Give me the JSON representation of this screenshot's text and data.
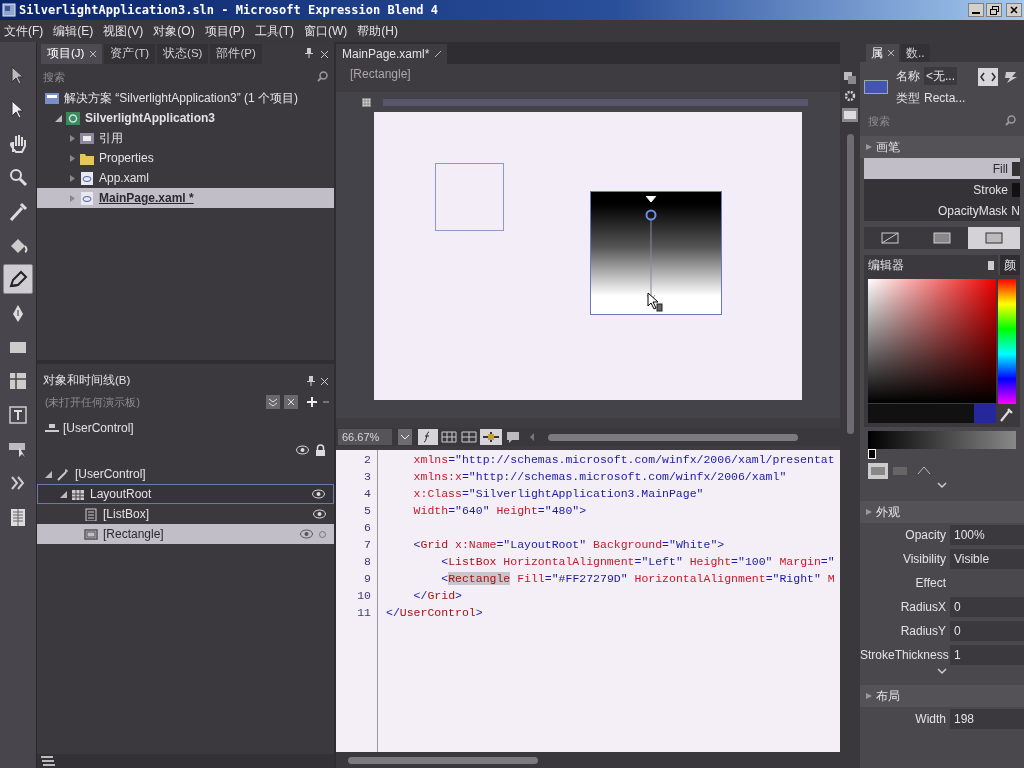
{
  "window": {
    "title": "SilverlightApplication3.sln - Microsoft Expression Blend 4"
  },
  "menu": [
    "文件(F)",
    "编辑(E)",
    "视图(V)",
    "对象(O)",
    "项目(P)",
    "工具(T)",
    "窗口(W)",
    "帮助(H)"
  ],
  "tools": [
    {
      "selected": false
    },
    {
      "selected": false
    },
    {
      "selected": false
    },
    {
      "selected": false
    },
    {
      "selected": false
    },
    {
      "selected": false
    },
    {
      "selected": true
    },
    {
      "selected": false
    },
    {
      "selected": false
    },
    {
      "selected": false
    },
    {
      "selected": false
    },
    {
      "selected": false
    },
    {
      "selected": false
    },
    {
      "selected": false
    }
  ],
  "project_panel": {
    "tabs": [
      {
        "label": "项目(J)",
        "selected": true
      },
      {
        "label": "资产(T)",
        "selected": false
      },
      {
        "label": "状态(S)",
        "selected": false
      },
      {
        "label": "部件(P)",
        "selected": false
      }
    ],
    "search": {
      "placeholder": "搜索"
    },
    "tree": [
      {
        "kind": "solution",
        "label": "解决方案 “SilverlightApplication3” (1 个项目)",
        "selected": false,
        "children": [
          {
            "kind": "project",
            "label": "SilverlightApplication3",
            "expanded": true,
            "selected": false,
            "children": [
              {
                "kind": "references",
                "label": "引用",
                "expanded": false,
                "selected": false
              },
              {
                "kind": "folder",
                "label": "Properties",
                "expanded": false,
                "selected": false
              },
              {
                "kind": "xaml",
                "label": "App.xaml",
                "expanded": false,
                "selected": false
              },
              {
                "kind": "xaml",
                "label": "MainPage.xaml *",
                "expanded": false,
                "selected": true
              }
            ]
          }
        ]
      }
    ]
  },
  "objects_panel": {
    "title": "对象和时间线(B)",
    "search": {
      "placeholder": "(未打开任何演示板)"
    },
    "scope": "[UserControl]",
    "tree": [
      {
        "kind": "usercontrol",
        "label": "[UserControl]",
        "expanded": true,
        "selected": false,
        "children": [
          {
            "kind": "grid",
            "label": "LayoutRoot",
            "expanded": true,
            "selected": false,
            "children": [
              {
                "kind": "listbox",
                "label": "[ListBox]",
                "selected": false
              },
              {
                "kind": "rectangle",
                "label": "[Rectangle]",
                "selected": true
              }
            ]
          }
        ]
      }
    ]
  },
  "document": {
    "tab": "MainPage.xaml*",
    "breadcrumb": "[Rectangle]",
    "zoom": "66.67%",
    "code": [
      {
        "number": "2",
        "tokens": [
          {
            "kind": "attr",
            "text": "    xmlns"
          },
          {
            "kind": "punct",
            "text": "="
          },
          {
            "kind": "value",
            "text": "\"http://schemas.microsoft.com/winfx/2006/xaml/presentat"
          }
        ]
      },
      {
        "number": "3",
        "tokens": [
          {
            "kind": "attr",
            "text": "    xmlns:x"
          },
          {
            "kind": "punct",
            "text": "="
          },
          {
            "kind": "value",
            "text": "\"http://schemas.microsoft.com/winfx/2006/xaml\""
          }
        ]
      },
      {
        "number": "4",
        "tokens": [
          {
            "kind": "attr",
            "text": "    x:Class"
          },
          {
            "kind": "punct",
            "text": "="
          },
          {
            "kind": "value",
            "text": "\"SilverlightApplication3.MainPage\""
          }
        ]
      },
      {
        "number": "5",
        "tokens": [
          {
            "kind": "attr",
            "text": "    Width"
          },
          {
            "kind": "punct",
            "text": "="
          },
          {
            "kind": "value",
            "text": "\"640\""
          },
          {
            "kind": "attr",
            "text": " Height"
          },
          {
            "kind": "punct",
            "text": "="
          },
          {
            "kind": "value",
            "text": "\"480\""
          },
          {
            "kind": "punct",
            "text": ">"
          }
        ]
      },
      {
        "number": "6"
      },
      {
        "number": "7",
        "tokens": [
          {
            "kind": "punct",
            "text": "    <"
          },
          {
            "kind": "tag",
            "text": "Grid"
          },
          {
            "kind": "attr",
            "text": " x:Name"
          },
          {
            "kind": "punct",
            "text": "="
          },
          {
            "kind": "value",
            "text": "\"LayoutRoot\""
          },
          {
            "kind": "attr",
            "text": " Background"
          },
          {
            "kind": "punct",
            "text": "="
          },
          {
            "kind": "value",
            "text": "\"White\""
          },
          {
            "kind": "punct",
            "text": ">"
          }
        ]
      },
      {
        "number": "8",
        "tokens": [
          {
            "kind": "punct",
            "text": "        <"
          },
          {
            "kind": "tag",
            "text": "ListBox"
          },
          {
            "kind": "attr",
            "text": " HorizontalAlignment"
          },
          {
            "kind": "punct",
            "text": "="
          },
          {
            "kind": "value",
            "text": "\"Left\""
          },
          {
            "kind": "attr",
            "text": " Height"
          },
          {
            "kind": "punct",
            "text": "="
          },
          {
            "kind": "value",
            "text": "\"100\""
          },
          {
            "kind": "attr",
            "text": " Margin"
          },
          {
            "kind": "punct",
            "text": "="
          },
          {
            "kind": "value",
            "text": "\""
          }
        ]
      },
      {
        "number": "9",
        "tokens": [
          {
            "kind": "punct",
            "text": "        <"
          },
          {
            "kind": "highlight",
            "text": "Rectangle"
          },
          {
            "kind": "attr",
            "text": " Fill"
          },
          {
            "kind": "punct",
            "text": "="
          },
          {
            "kind": "value",
            "text": "\"#FF27279D\""
          },
          {
            "kind": "attr",
            "text": " HorizontalAlignment"
          },
          {
            "kind": "punct",
            "text": "="
          },
          {
            "kind": "value",
            "text": "\"Right\""
          },
          {
            "kind": "attr",
            "text": " M"
          }
        ]
      },
      {
        "number": "10",
        "tokens": [
          {
            "kind": "punct",
            "text": "    </"
          },
          {
            "kind": "tag",
            "text": "Grid"
          },
          {
            "kind": "punct",
            "text": ">"
          }
        ]
      },
      {
        "number": "11",
        "tokens": [
          {
            "kind": "punct",
            "text": "</"
          },
          {
            "kind": "tag",
            "text": "UserControl"
          },
          {
            "kind": "punct",
            "text": ">"
          }
        ]
      }
    ]
  },
  "properties_panel": {
    "tabs": [
      {
        "label": "属",
        "selected": true
      },
      {
        "label": "数..",
        "selected": false
      }
    ],
    "name_label": "名称",
    "name_value": "<无...",
    "type_label": "类型",
    "type_value": "Recta...",
    "search": {
      "placeholder": "搜索"
    },
    "brush_section": "画笔",
    "brushes": [
      {
        "label": "Fill",
        "selected": true
      },
      {
        "label": "Stroke",
        "selected": false
      },
      {
        "label": "OpacityMask",
        "selected": false,
        "value": "N"
      }
    ],
    "brush_types": [
      {
        "selected": false
      },
      {
        "selected": false
      },
      {
        "selected": true
      }
    ],
    "editor_tabs": [
      {
        "label": "编辑器",
        "selected": true
      },
      {
        "label": "颜",
        "selected": false
      }
    ],
    "appearance_section": "外观",
    "appearance": [
      {
        "label": "Opacity",
        "value": "100%"
      },
      {
        "label": "Visibility",
        "value": "Visible"
      },
      {
        "label": "Effect"
      },
      {
        "label": "RadiusX",
        "value": "0"
      },
      {
        "label": "RadiusY",
        "value": "0"
      },
      {
        "label": "StrokeThickness",
        "value": "1"
      }
    ],
    "layout_section": "布局",
    "layout": [
      {
        "label": "Width",
        "value": "198"
      }
    ]
  }
}
